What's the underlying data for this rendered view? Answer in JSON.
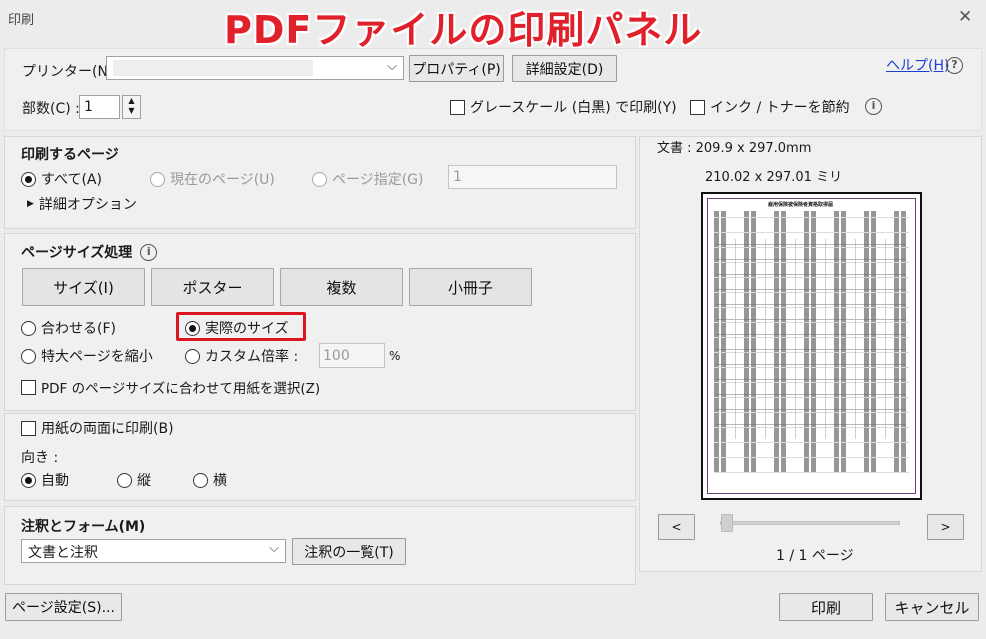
{
  "window": {
    "title": "印刷",
    "overlay_title": "PDFファイルの印刷パネル",
    "close_glyph": "✕"
  },
  "header": {
    "printer_label": "プリンター(N) :",
    "printer_value": "",
    "properties_button": "プロパティ(P)",
    "advanced_button": "詳細設定(D)",
    "help_link": "ヘルプ(H)",
    "copies_label": "部数(C) :",
    "copies_value": "1",
    "grayscale_label": "グレースケール (白黒) で印刷(Y)",
    "ink_save_label": "インク / トナーを節約"
  },
  "pages": {
    "heading": "印刷するページ",
    "all": "すべて(A)",
    "current": "現在のページ(U)",
    "specify": "ページ指定(G)",
    "range_value": "1",
    "more_options": "詳細オプション"
  },
  "size": {
    "heading": "ページサイズ処理",
    "tabs": [
      "サイズ(I)",
      "ポスター",
      "複数",
      "小冊子"
    ],
    "fit": "合わせる(F)",
    "actual": "実際のサイズ",
    "shrink": "特大ページを縮小",
    "custom": "カスタム倍率 :",
    "custom_value": "100",
    "percent": "%",
    "pdf_paper": "PDF のページサイズに合わせて用紙を選択(Z)"
  },
  "duplex": {
    "label": "用紙の両面に印刷(B)"
  },
  "orientation": {
    "label": "向き :",
    "auto": "自動",
    "portrait": "縦",
    "landscape": "横"
  },
  "comments": {
    "heading": "注釈とフォーム(M)",
    "select_value": "文書と注釈",
    "summary_button": "注釈の一覧(T)"
  },
  "preview": {
    "doc_size": "文書 : 209.9 x 297.0mm",
    "paper_size": "210.02 x 297.01 ミリ",
    "prev": "<",
    "next": ">",
    "page_indicator": "1 / 1 ページ",
    "form_title": "雇用保険被保険者資格取得届",
    "slider_position": 0
  },
  "footer": {
    "page_setup": "ページ設定(S)...",
    "print": "印刷",
    "cancel": "キャンセル"
  }
}
